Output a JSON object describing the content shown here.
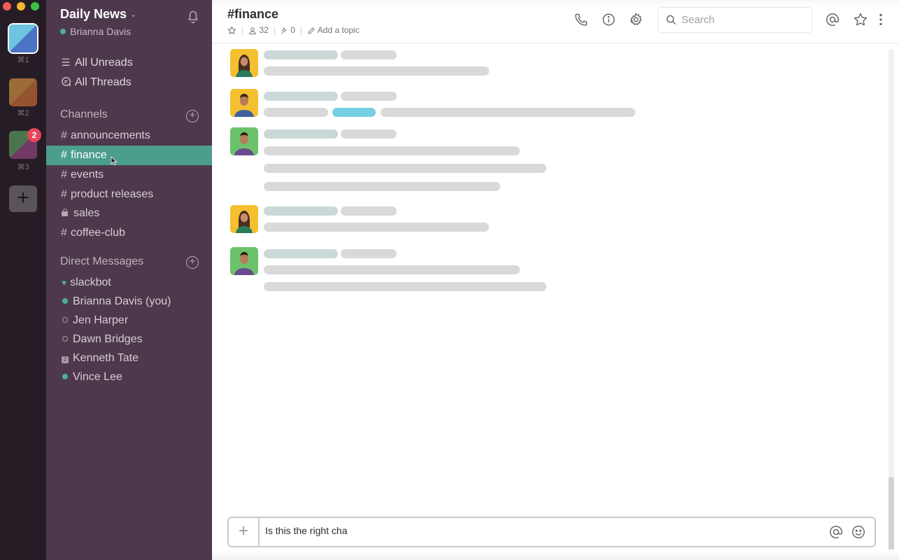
{
  "window": {
    "traffic_lights": [
      "#ee5c54",
      "#f5b731",
      "#3cc146"
    ]
  },
  "workspaces": [
    {
      "shortcut": "⌘1",
      "active": true
    },
    {
      "shortcut": "⌘2",
      "active": false
    },
    {
      "shortcut": "⌘3",
      "active": false,
      "badge": "2"
    }
  ],
  "workspace_add_label": "+",
  "sidebar": {
    "team_name": "Daily News",
    "user_name": "Brianna Davis",
    "nav": [
      {
        "label": "All Unreads",
        "icon": "list-icon"
      },
      {
        "label": "All Threads",
        "icon": "threads-icon"
      }
    ],
    "channels_header": "Channels",
    "channels": [
      {
        "prefix": "#",
        "label": "announcements",
        "active": false
      },
      {
        "prefix": "#",
        "label": "finance",
        "active": true
      },
      {
        "prefix": "#",
        "label": "events",
        "active": false
      },
      {
        "prefix": "#",
        "label": "product releases",
        "active": false
      },
      {
        "prefix": "lock",
        "label": "sales",
        "active": false
      },
      {
        "prefix": "#",
        "label": "coffee-club",
        "active": false
      }
    ],
    "dm_header": "Direct Messages",
    "direct_messages": [
      {
        "label": "slackbot",
        "status": "heart"
      },
      {
        "label": "Brianna Davis (you)",
        "status": "online"
      },
      {
        "label": "Jen Harper",
        "status": "away"
      },
      {
        "label": "Dawn Bridges",
        "status": "away"
      },
      {
        "label": "Kenneth Tate",
        "status": "group",
        "count": "2"
      },
      {
        "label": "Vince Lee",
        "status": "online"
      }
    ]
  },
  "header": {
    "channel_title": "#finance",
    "member_count": "32",
    "pinned_count": "0",
    "add_topic": "Add a topic",
    "search_placeholder": "Search"
  },
  "messages": [
    {
      "avatar": "woman-yellow",
      "lines": 1
    },
    {
      "avatar": "man-yellow",
      "lines": 1,
      "has_link": true
    },
    {
      "avatar": "man-green",
      "lines": 3
    },
    {
      "avatar": "woman-yellow",
      "lines": 1
    },
    {
      "avatar": "man-green",
      "lines": 2
    }
  ],
  "scroll": {
    "position_fraction": 1.0
  },
  "composer": {
    "value": "Is this the right cha",
    "plus_label": "+"
  },
  "colors": {
    "sidebar_bg": "#4d394b",
    "active_channel": "#4c9e8c",
    "rail_bg": "#261c26",
    "badge": "#e8455a",
    "presence": "#4fb09a"
  }
}
